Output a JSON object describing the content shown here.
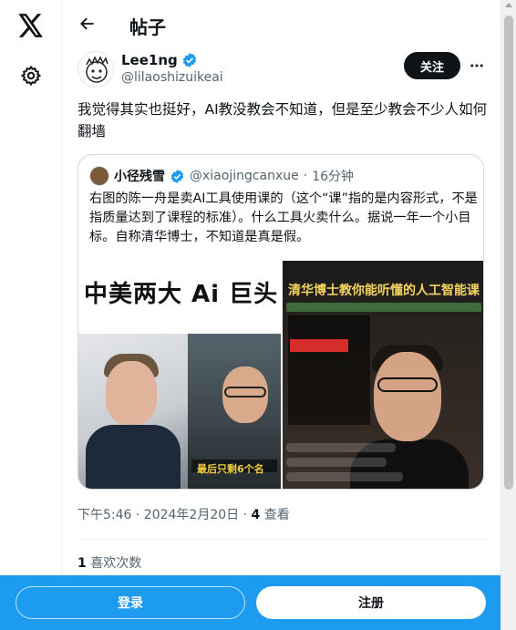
{
  "app": {
    "logo_icon": "x-logo-icon",
    "settings_icon": "gear-icon"
  },
  "header": {
    "title": "帖子",
    "back_icon": "arrow-left-icon"
  },
  "author": {
    "name": "Lee1ng",
    "handle": "@lilaoshizuikeai",
    "verified_icon": "verified-badge-icon",
    "follow_label": "关注",
    "more_icon": "more-dots-icon"
  },
  "tweet": {
    "text": "我觉得其实也挺好，AI教没教会不知道，但是至少教会不少人如何翻墙"
  },
  "quote": {
    "name": "小径残雪",
    "handle": "@xiaojingcanxue",
    "dot": "·",
    "time": "16分钟",
    "text": "右图的陈一舟是卖AI工具使用课的（这个“课”指的是内容形式，不是指质量达到了课程的标准）。什么工具火卖什么。据说一年一个小目标。自称清华博士，不知道是真是假。",
    "media": {
      "left_title": "中美两大 Ai 巨头",
      "left_caption": "最后只剩6个名",
      "right_title": "清华博士教你能听懂的人工智能课"
    }
  },
  "meta": {
    "time": "下午5:46 · 2024年2月20日 · ",
    "views_count": "4",
    "views_label": " 查看"
  },
  "stats": {
    "likes_count": "1",
    "likes_label": " 喜欢次数"
  },
  "bottom_bar": {
    "login_label": "登录",
    "signup_label": "注册"
  },
  "colors": {
    "accent": "#1d9bf0",
    "text": "#0f1419",
    "muted": "#536471"
  }
}
